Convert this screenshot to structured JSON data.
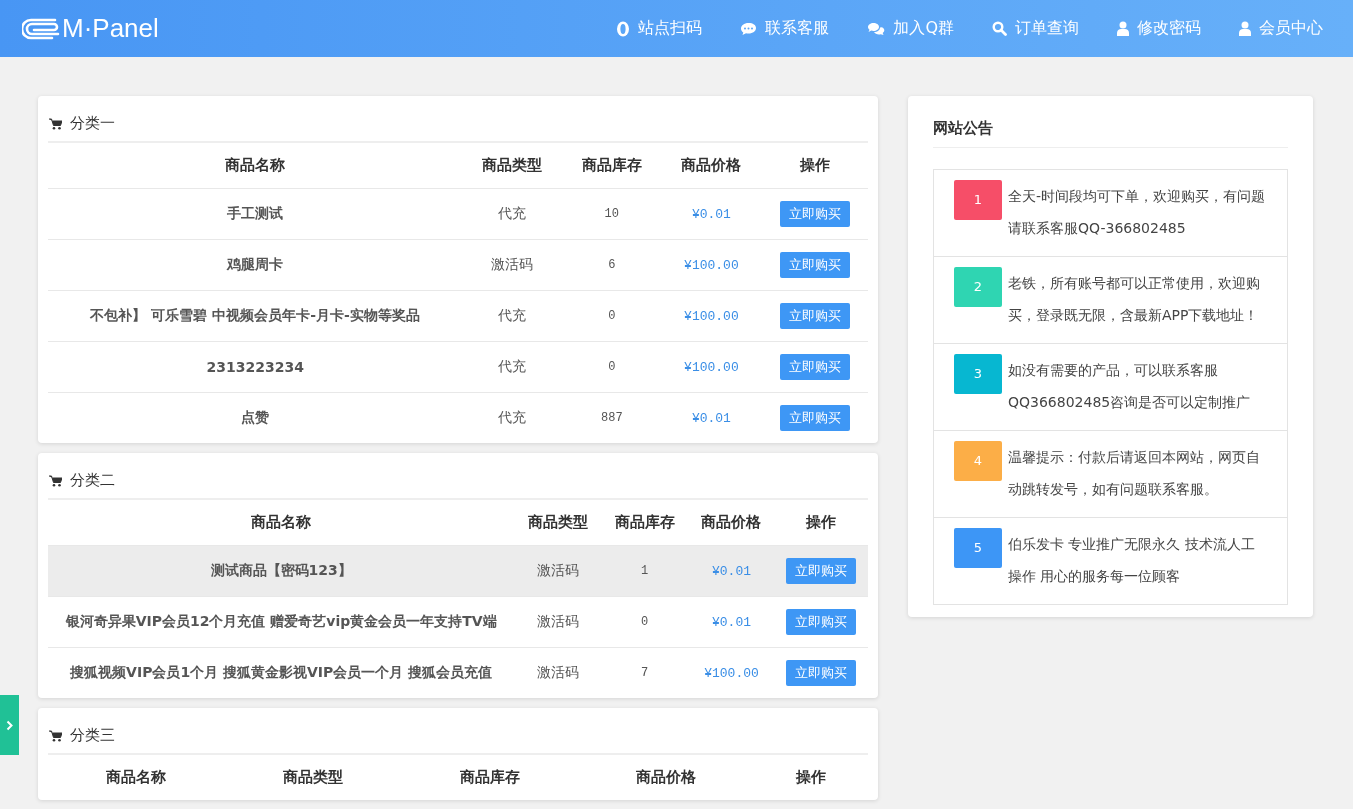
{
  "header": {
    "logo": "M·Panel",
    "nav": [
      {
        "label": "站点扫码",
        "kind": "ring"
      },
      {
        "label": "联系客服",
        "kind": "bubble"
      },
      {
        "label": "加入Q群",
        "kind": "bubbles"
      },
      {
        "label": "订单查询",
        "kind": "search"
      },
      {
        "label": "修改密码",
        "kind": "user"
      },
      {
        "label": "会员中心",
        "kind": "user"
      }
    ]
  },
  "categories": [
    {
      "title": "分类一",
      "columns": [
        "商品名称",
        "商品类型",
        "商品库存",
        "商品价格",
        "操作"
      ],
      "rows": [
        {
          "name": "手工测试",
          "type": "代充",
          "stock": "10",
          "price": "¥0.01",
          "action": "立即购买",
          "highlighted": false
        },
        {
          "name": "鸡腿周卡",
          "type": "激活码",
          "stock": "6",
          "price": "¥100.00",
          "action": "立即购买",
          "highlighted": false
        },
        {
          "name": "不包补】 可乐雪碧 中视频会员年卡-月卡-实物等奖品",
          "type": "代充",
          "stock": "0",
          "price": "¥100.00",
          "action": "立即购买",
          "highlighted": false
        },
        {
          "name": "2313223234",
          "type": "代充",
          "stock": "0",
          "price": "¥100.00",
          "action": "立即购买",
          "highlighted": false
        },
        {
          "name": "点赞",
          "type": "代充",
          "stock": "887",
          "price": "¥0.01",
          "action": "立即购买",
          "highlighted": false
        }
      ]
    },
    {
      "title": "分类二",
      "columns": [
        "商品名称",
        "商品类型",
        "商品库存",
        "商品价格",
        "操作"
      ],
      "rows": [
        {
          "name": "测试商品【密码123】",
          "type": "激活码",
          "stock": "1",
          "price": "¥0.01",
          "action": "立即购买",
          "highlighted": true
        },
        {
          "name": "银河奇异果VIP会员12个月充值 赠爱奇艺vip黄金会员一年支持TV端",
          "type": "激活码",
          "stock": "0",
          "price": "¥0.01",
          "action": "立即购买",
          "highlighted": false
        },
        {
          "name": "搜狐视频VIP会员1个月 搜狐黄金影视VIP会员一个月 搜狐会员充值",
          "type": "激活码",
          "stock": "7",
          "price": "¥100.00",
          "action": "立即购买",
          "highlighted": false
        }
      ]
    },
    {
      "title": "分类三",
      "columns": [
        "商品名称",
        "商品类型",
        "商品库存",
        "商品价格",
        "操作"
      ]
    }
  ],
  "notices": {
    "title": "网站公告",
    "items": [
      {
        "number": "1",
        "color": "#f64e68",
        "text": "全天-时间段均可下单，欢迎购买，有问题请联系客服QQ-366802485"
      },
      {
        "number": "2",
        "color": "#2fd5b2",
        "text": "老铁，所有账号都可以正常使用，欢迎购买，登录既无限，含最新APP下载地址！"
      },
      {
        "number": "3",
        "color": "#07b7d1",
        "text": "如没有需要的产品，可以联系客服QQ366802485咨询是否可以定制推广"
      },
      {
        "number": "4",
        "color": "#fcae47",
        "text": "温馨提示：付款后请返回本网站，网页自动跳转发号，如有问题联系客服。"
      },
      {
        "number": "5",
        "color": "#3d96f6",
        "text": "伯乐发卡 专业推广无限永久 技术流人工操作 用心的服务每一位顾客"
      }
    ]
  }
}
